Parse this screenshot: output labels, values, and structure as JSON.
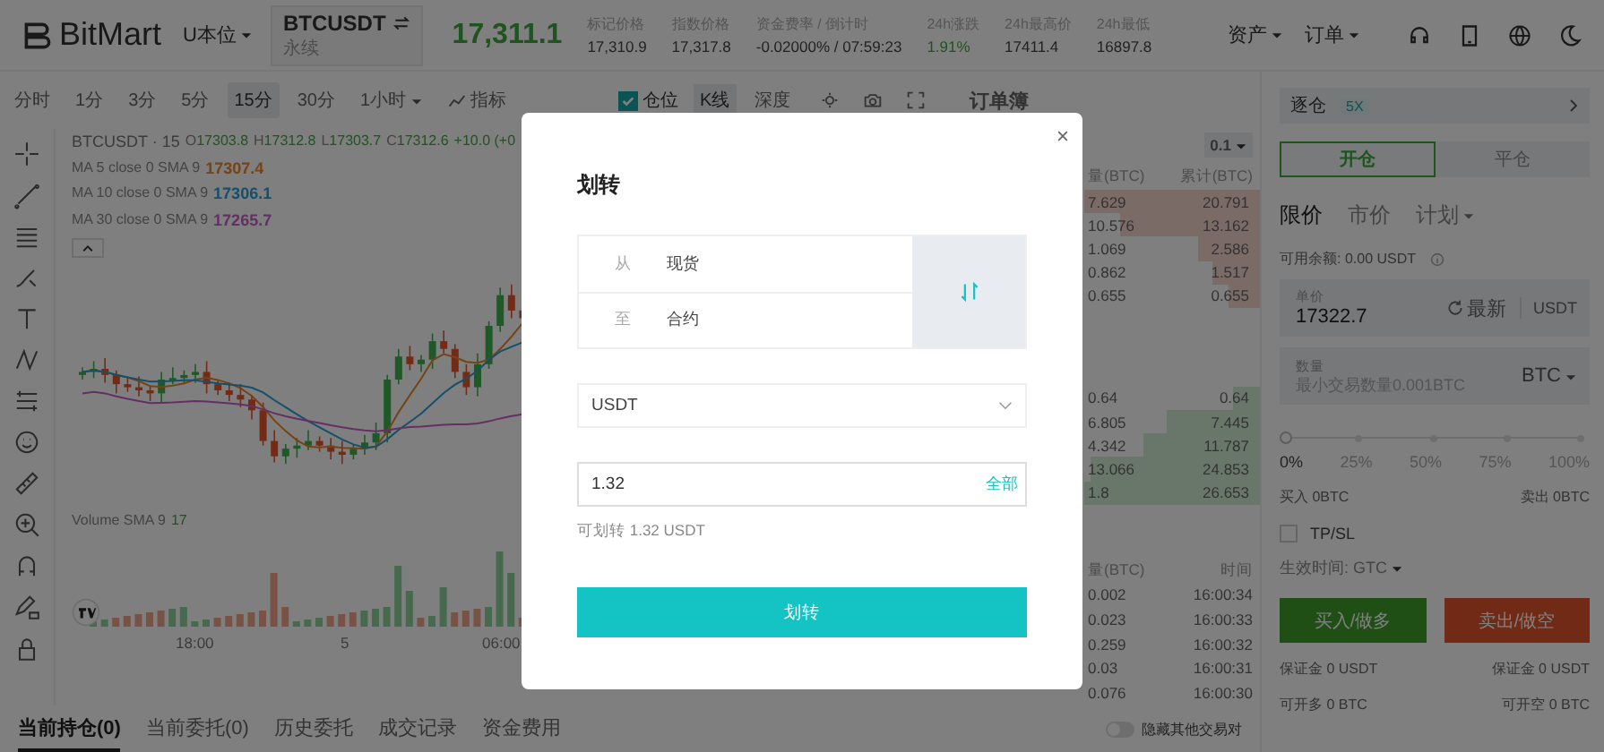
{
  "header": {
    "logo": "BitMart",
    "market_menu": "U本位",
    "symbol": "BTCUSDT",
    "contract_type": "永续",
    "last_price": "17,311.1",
    "stats": [
      {
        "label": "标记价格",
        "value": "17,310.9",
        "kind": "plain"
      },
      {
        "label": "指数价格",
        "value": "17,317.8",
        "kind": "plain"
      },
      {
        "label": "资金费率 / 倒计时",
        "value": "-0.02000% / 07:59:23",
        "kind": "plain"
      },
      {
        "label": "24h涨跌",
        "value": "1.91%",
        "kind": "up"
      },
      {
        "label": "24h最高价",
        "value": "17411.4",
        "kind": "plain"
      },
      {
        "label": "24h最低",
        "value": "16897.8",
        "kind": "plain"
      }
    ],
    "menus": [
      "资产",
      "订单"
    ]
  },
  "chart_toolbar": {
    "intervals": [
      {
        "label": "分时",
        "selected": false,
        "dropdown": false
      },
      {
        "label": "1分",
        "selected": false,
        "dropdown": false
      },
      {
        "label": "3分",
        "selected": false,
        "dropdown": false
      },
      {
        "label": "5分",
        "selected": false,
        "dropdown": false
      },
      {
        "label": "15分",
        "selected": true,
        "dropdown": false
      },
      {
        "label": "30分",
        "selected": false,
        "dropdown": false
      },
      {
        "label": "1小时",
        "selected": false,
        "dropdown": true
      }
    ],
    "indicators": "指标",
    "position_toggle": {
      "label": "仓位",
      "checked": true
    },
    "views": [
      {
        "label": "K线",
        "selected": true
      },
      {
        "label": "深度",
        "selected": false
      }
    ],
    "orderbook_title": "订单簿"
  },
  "chart": {
    "symbol": "BTCUSDT · 15",
    "ohlc": [
      {
        "label": "O",
        "value": "17303.8"
      },
      {
        "label": "H",
        "value": "17312.8"
      },
      {
        "label": "L",
        "value": "17303.7"
      },
      {
        "label": "C",
        "value": "17312.6"
      }
    ],
    "change": "+10.0 (+0",
    "ma": [
      {
        "name": "MA 5 close 0 SMA 9",
        "value": "17307.4"
      },
      {
        "name": "MA 10 close 0 SMA 9",
        "value": "17306.1"
      },
      {
        "name": "MA 30 close 0 SMA 9",
        "value": "17265.7"
      }
    ],
    "volume": {
      "name": "Volume SMA 9",
      "value": "17"
    },
    "time_labels": [
      "18:00",
      "5",
      "06:00"
    ]
  },
  "order_book": {
    "precision": "0.1",
    "columns": [
      "量(BTC)",
      "累计(BTC)"
    ],
    "asks": [
      {
        "amount": "7.629",
        "total": "20.791"
      },
      {
        "amount": "10.576",
        "total": "13.162"
      },
      {
        "amount": "1.069",
        "total": "2.586"
      },
      {
        "amount": "0.862",
        "total": "1.517"
      },
      {
        "amount": "0.655",
        "total": "0.655"
      }
    ],
    "bids": [
      {
        "amount": "0.64",
        "total": "0.64"
      },
      {
        "amount": "6.805",
        "total": "7.445"
      },
      {
        "amount": "4.342",
        "total": "11.787"
      },
      {
        "amount": "13.066",
        "total": "24.853"
      },
      {
        "amount": "1.8",
        "total": "26.653"
      }
    ]
  },
  "trades": {
    "columns": [
      "量(BTC)",
      "时间"
    ],
    "rows": [
      {
        "amount": "0.002",
        "time": "16:00:34"
      },
      {
        "amount": "0.023",
        "time": "16:00:33"
      },
      {
        "amount": "0.259",
        "time": "16:00:32"
      },
      {
        "amount": "0.03",
        "time": "16:00:31"
      },
      {
        "amount": "0.076",
        "time": "16:00:30"
      }
    ]
  },
  "order_form": {
    "margin_mode": "逐仓",
    "leverage": "5X",
    "tabs": [
      {
        "label": "开仓",
        "selected": true
      },
      {
        "label": "平仓",
        "selected": false
      }
    ],
    "order_types": [
      {
        "label": "限价",
        "selected": true,
        "dropdown": false
      },
      {
        "label": "市价",
        "selected": false,
        "dropdown": false
      },
      {
        "label": "计划",
        "selected": false,
        "dropdown": true
      }
    ],
    "balance": "可用余额: 0.00 USDT",
    "price": {
      "label": "单价",
      "value": "17322.7",
      "refresh": "最新",
      "unit": "USDT"
    },
    "quantity": {
      "label": "数量",
      "placeholder": "最小交易数量0.001BTC",
      "unit": "BTC"
    },
    "slider": {
      "level": 0,
      "marks": [
        "0%",
        "25%",
        "50%",
        "75%",
        "100%"
      ]
    },
    "buy_amount": "买入 0BTC",
    "sell_amount": "卖出 0BTC",
    "tpsl": {
      "label": "TP/SL",
      "checked": false
    },
    "time_in_force": "生效时间: GTC",
    "buy_button": "买入/做多",
    "sell_button": "卖出/做空",
    "summary": [
      [
        "保证金 0 USDT",
        "保证金 0 USDT"
      ],
      [
        "可开多 0 BTC",
        "可开空 0 BTC"
      ]
    ]
  },
  "bottom_tabs": [
    {
      "label": "当前持仓(0)",
      "selected": true
    },
    {
      "label": "当前委托(0)",
      "selected": false
    },
    {
      "label": "历史委托",
      "selected": false
    },
    {
      "label": "成交记录",
      "selected": false
    },
    {
      "label": "资金费用",
      "selected": false
    }
  ],
  "hide_pairs": {
    "label": "隐藏其他交易对",
    "on": false
  },
  "modal": {
    "title": "划转",
    "from_label": "从",
    "from_value": "现货",
    "to_label": "至",
    "to_value": "合约",
    "currency": "USDT",
    "amount": "1.32",
    "all_button": "全部",
    "available": "可划转 1.32 USDT",
    "submit": "划转"
  }
}
